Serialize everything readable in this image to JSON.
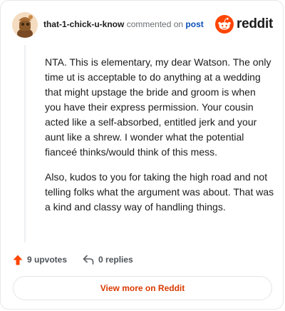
{
  "header": {
    "username": "that-1-chick-u-know",
    "action_text": "commented on",
    "post_link": "post",
    "brand": "reddit"
  },
  "comment": {
    "paragraphs": [
      "NTA. This is elementary, my dear Watson. The only time ut is acceptable to do anything at a wedding that might upstage the bride and groom is when you have their express permission. Your cousin acted like a self-absorbed, entitled jerk and your aunt like a shrew. I wonder what the potential fianceé thinks/would think of this mess.",
      "Also, kudos to you for taking the high road and not telling folks what the argument was about. That was a kind and classy way of handling things."
    ]
  },
  "actions": {
    "upvotes": "9 upvotes",
    "replies": "0 replies"
  },
  "footer": {
    "view_more": "View more on Reddit"
  },
  "colors": {
    "accent": "#d93a00",
    "upvote": "#ff4500",
    "link": "#0b4fb8"
  },
  "icons": {
    "upvote": "upvote-arrow-icon",
    "reply": "reply-arrow-icon",
    "brand": "reddit-snoo-icon"
  }
}
